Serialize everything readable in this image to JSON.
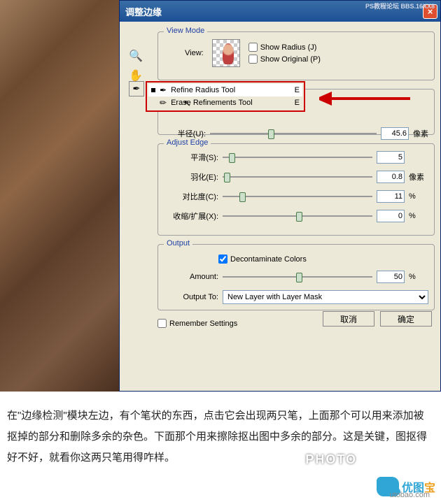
{
  "dialog": {
    "title": "调整边缘",
    "watermark": "PS教程论坛\nBBS.16XX8"
  },
  "viewMode": {
    "legend": "View Mode",
    "viewLabel": "View:",
    "showRadius": "Show Radius (J)",
    "showOriginal": "Show Original (P)"
  },
  "edgeDetect": {
    "tool1": "Refine Radius Tool",
    "tool2": "Erase Refinements Tool",
    "key": "E",
    "radiusLabel": "半径(U):",
    "radiusValue": "45.6",
    "radiusUnit": "像素"
  },
  "adjustEdge": {
    "legend": "Adjust Edge",
    "smooth": {
      "label": "平滑(S):",
      "value": "5",
      "unit": ""
    },
    "feather": {
      "label": "羽化(E):",
      "value": "0.8",
      "unit": "像素"
    },
    "contrast": {
      "label": "对比度(C):",
      "value": "11",
      "unit": "%"
    },
    "shift": {
      "label": "收缩/扩展(X):",
      "value": "0",
      "unit": "%"
    }
  },
  "output": {
    "legend": "Output",
    "decon": "Decontaminate Colors",
    "amountLabel": "Amount:",
    "amountValue": "50",
    "amountUnit": "%",
    "outputToLabel": "Output To:",
    "outputToValue": "New Layer with Layer Mask"
  },
  "remember": "Remember Settings",
  "buttons": {
    "cancel": "取消",
    "ok": "确定"
  },
  "paragraph": "在\"边缘检测\"模块左边，有个笔状的东西，点击它会出现两只笔，上面那个可以用来添加被抠掉的部分和删除多余的杂色。下面那个用来擦除抠出图中多余的部分。这是关键，图抠得好不好，就看你这两只笔用得咋样。",
  "logo": {
    "part1": "优图",
    "part2": "宝",
    "sub": "utobao.com"
  },
  "photowm": "PHOTO"
}
